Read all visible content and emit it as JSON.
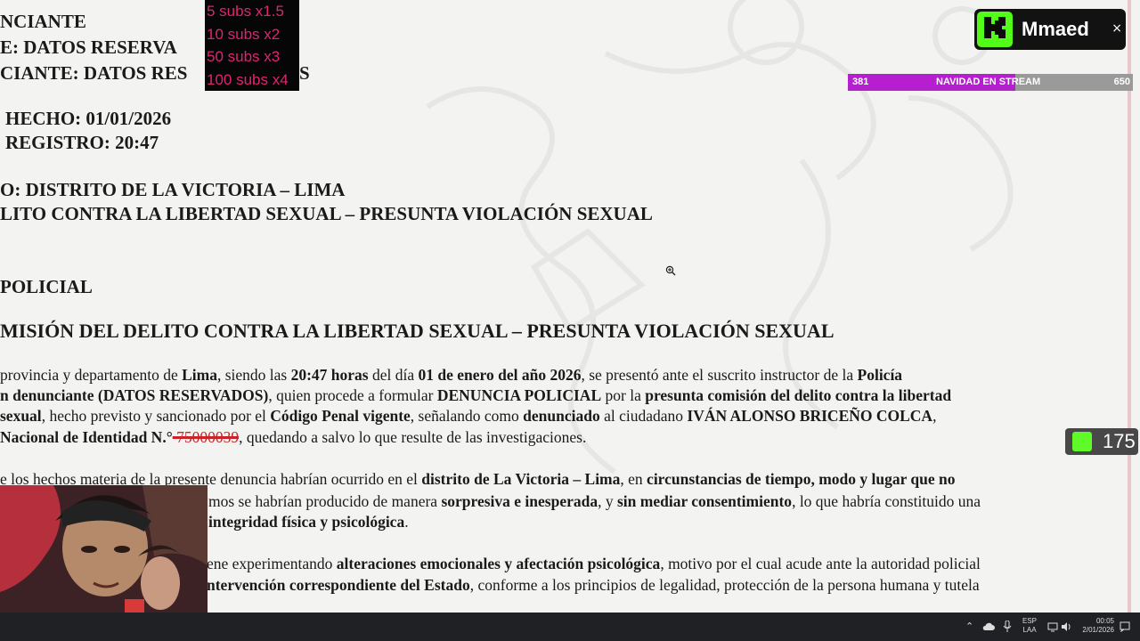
{
  "document": {
    "header_lines": [
      "NCIANTE",
      "E: DATOS RESERVA",
      "CIANTE: DATOS RES",
      "S"
    ],
    "fecha_hecho": "HECHO: 01/01/2026",
    "hora_registro": "REGISTRO: 20:47",
    "lugar": "O: DISTRITO DE LA VICTORIA – LIMA",
    "delito": "LITO CONTRA LA LIBERTAD SEXUAL – PRESUNTA VIOLACIÓN SEXUAL",
    "section_policial": "POLICIAL",
    "section_comision": "MISIÓN DEL DELITO CONTRA LA LIBERTAD SEXUAL – PRESUNTA VIOLACIÓN SEXUAL",
    "p1": {
      "l1a": "provincia y departamento de ",
      "l1b": "Lima",
      "l1c": ", siendo las ",
      "l1d": "20:47 horas",
      "l1e": " del día ",
      "l1f": "01 de enero del año 2026",
      "l1g": ", se presentó ante el suscrito instructor de la ",
      "l1h": "Policía",
      "l2a": "n denunciante (DATOS RESERVADOS)",
      "l2b": ", quien procede a formular ",
      "l2c": "DENUNCIA POLICIAL",
      "l2d": " por la ",
      "l2e": "presunta comisión del delito contra la libertad",
      "l3a": "sexual",
      "l3b": ", hecho previsto y sancionado por el ",
      "l3c": "Código Penal vigente",
      "l3d": ", señalando como ",
      "l3e": "denunciado",
      "l3f": " al ciudadano ",
      "l3g": "IVÁN ALONSO BRICEÑO COLCA",
      "l3h": ",",
      "l4a": "Nacional de Identidad N.°",
      "l4b": " 75000039",
      "l4c": ", quedando a salvo lo que resulte de las investigaciones."
    },
    "p2": {
      "l1a": "e los hechos materia de la presente denuncia habrían ocurrido en el ",
      "l1b": "distrito de La Victoria – Lima",
      "l1c": ", en ",
      "l1d": "circunstancias de tiempo, modo y lugar que no",
      "l2a": "mos se habrían producido de manera ",
      "l2b": "sorpresiva e inesperada",
      "l2c": ", y ",
      "l2d": "sin mediar consentimiento",
      "l2e": ", lo que habría constituido una",
      "l3a": "integridad física y psicológica",
      "l3b": "."
    },
    "p3": {
      "l1a": "ene experimentando ",
      "l1b": "alteraciones emocionales y afectación psicológica",
      "l1c": ", motivo por el cual acude ante la autoridad policial",
      "l2a": "ntervención correspondiente del Estado",
      "l2b": ", conforme a los principios de legalidad, protección de la persona humana y tutela"
    }
  },
  "subs_overlay": [
    "5 subs x1.5",
    "10 subs x2",
    "50 subs x3",
    "100 subs x4"
  ],
  "brand": {
    "name": "Mmaed",
    "close": "×"
  },
  "goal": {
    "current": "381",
    "title": "NAVIDAD EN STREAM",
    "target": "650",
    "progress": 0.586
  },
  "viewers": {
    "count": "175"
  },
  "taskbar": {
    "lang1": "ESP",
    "lang2": "LAA",
    "time": "00:05",
    "date": "2/01/2026"
  },
  "icons": [
    "zoom-in-icon",
    "kick-logo-icon",
    "close-icon",
    "chevron-up-icon",
    "cloud-icon",
    "mic-icon",
    "volume-icon",
    "network-icon",
    "notification-icon"
  ],
  "colors": {
    "accent_green": "#53fc18",
    "goal_purple": "#b51fd0",
    "subs_pink": "#e0246f"
  }
}
